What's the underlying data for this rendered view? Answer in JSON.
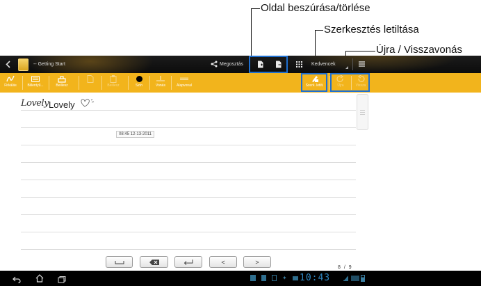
{
  "callouts": {
    "insert_delete_page": "Oldal beszúrása/törlése",
    "disable_edit": "Szerkesztés letiltása",
    "redo_undo": "Újra / Visszavonás"
  },
  "topbar": {
    "back_icon": "chevron-left-icon",
    "notebook_title": "-- Getting Start",
    "share_label": "Megosztás",
    "favorites_label": "Kedvencek",
    "menu_icon": "overflow-menu-icon"
  },
  "toolbar": {
    "items": [
      {
        "label": "Firkálás",
        "icon": "scribble-icon"
      },
      {
        "label": "Billentyű...",
        "icon": "keyboard-icon"
      },
      {
        "label": "Beillesz",
        "icon": "insert-icon"
      },
      {
        "label": "",
        "icon": "cut-icon"
      },
      {
        "label": "Beillesz",
        "icon": "paste-icon"
      },
      {
        "label": "Szín",
        "icon": "color-dot-icon"
      },
      {
        "label": "Vonás",
        "icon": "stroke-icon"
      },
      {
        "label": "Alapvonal",
        "icon": "baseline-icon"
      },
      {
        "label": "Szerk. letilt.",
        "icon": "edit-lock-icon"
      },
      {
        "label": "Újra",
        "icon": "redo-icon"
      },
      {
        "label": "Vissza",
        "icon": "undo-icon"
      }
    ]
  },
  "note": {
    "handwriting": "Lovely",
    "typed_text": "Lovely",
    "timestamp": "08:45 12-13-2011"
  },
  "keys": {
    "space_icon": "space-key-icon",
    "delete_icon": "backspace-key-icon",
    "enter_icon": "enter-key-icon",
    "left": "<",
    "right": ">"
  },
  "pager": {
    "current": "8",
    "sep": "/",
    "total": "9"
  },
  "navbar": {
    "time": "10:43"
  },
  "colors": {
    "toolbar": "#f2b41c",
    "topbar": "#111111",
    "highlight": "#1e6fd0"
  }
}
